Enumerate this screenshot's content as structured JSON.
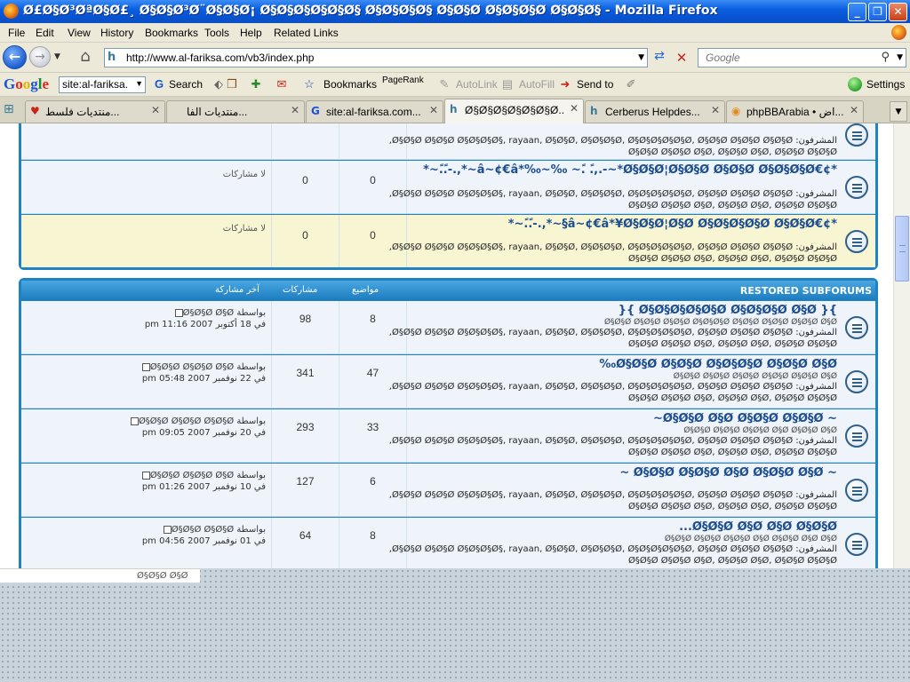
{
  "window": {
    "title": "Ø£Ø§Ø³ØªØ§Ø£¸ Ø§Ø§Ø³Ø¨Ø§Ø§Ø¡ Ø§Ø§Ø§Ø§Ø§Ø§ Ø§Ø§Ø§Ø§ Ø§Ø§Ø Ø§Ø§Ø§Ø Ø§Ø§Ø§ - Mozilla Firefox",
    "min_label": "_",
    "max_label": "❐",
    "close_label": "✕"
  },
  "menu": [
    "File",
    "Edit",
    "View",
    "History",
    "Bookmarks",
    "Tools",
    "Help",
    "Related Links"
  ],
  "nav": {
    "url": "http://www.al-fariksa.com/vb3/index.php",
    "search_placeholder": "Google"
  },
  "google_toolbar": {
    "logo": [
      "G",
      "o",
      "o",
      "g",
      "l",
      "e"
    ],
    "input_value": "site:al-fariksa.",
    "search_label": "Search",
    "bookmarks_label": "Bookmarks",
    "pagerank_label": "PageRank",
    "autolink_label": "AutoLink",
    "autofill_label": "AutoFill",
    "sendto_label": "Send to",
    "settings_label": "Settings"
  },
  "tabs": [
    {
      "label": "منتديات فلسط...",
      "active": false
    },
    {
      "label": "منتديات الفا...",
      "active": false
    },
    {
      "label": "site:al-fariksa.com...",
      "active": false
    },
    {
      "label": "Ø§Ø§Ø§Ø§Ø§Ø§Ø...",
      "active": true
    },
    {
      "label": "Cerberus Helpdes...",
      "active": false
    },
    {
      "label": "phpBBArabia • اض...",
      "active": false
    }
  ],
  "content": {
    "box1_rows": [
      {
        "mods_line1": "المشرفون: Ø§Ø§Ø Ø§Ø§Ø Ø§Ø§Ø§Ø§, rayaan, Ø§Ø§Ø, Ø§Ø§Ø§Ø, Ø§Ø§Ø§Ø§Ø§Ø, Ø§Ø§Ø Ø§Ø§Ø Ø§Ø§Ø,",
        "mods_line2": "Ø§Ø§Ø Ø§Ø§Ø Ø§Ø, Ø§Ø§Ø Ø§Ø, Ø§Ø§Ø Ø§Ø§Ø"
      },
      {
        "title": "*¢€â~¢€â*‰~‰ ~.ً .ً,.-~*Ø§Ø§Ø¦Ø§Ø§Ø Ø§Ø§Ø Ø§Ø§Ø§Ø~*,.-.ً.ً~*",
        "mods_line1": "المشرفون: Ø§Ø§Ø Ø§Ø§Ø Ø§Ø§Ø§Ø§, rayaan, Ø§Ø§Ø, Ø§Ø§Ø§Ø, Ø§Ø§Ø§Ø§Ø§Ø, Ø§Ø§Ø Ø§Ø§Ø Ø§Ø§Ø,",
        "mods_line2": "Ø§Ø§Ø Ø§Ø§Ø Ø§Ø, Ø§Ø§Ø Ø§Ø, Ø§Ø§Ø Ø§Ø§Ø",
        "topics": "0",
        "posts": "0",
        "last": "لا مشاركات"
      },
      {
        "title": "*¢€â~¢€â*¥Ø§Ø§Ø¦Ø§Ø Ø§Ø§Ø§Ø§Ø Ø§Ø§Ø§~*,.-.ً.ً~*",
        "mods_line1": "المشرفون: Ø§Ø§Ø Ø§Ø§Ø Ø§Ø§Ø§Ø§, rayaan, Ø§Ø§Ø, Ø§Ø§Ø§Ø, Ø§Ø§Ø§Ø§Ø§Ø, Ø§Ø§Ø Ø§Ø§Ø Ø§Ø§Ø,",
        "mods_line2": "Ø§Ø§Ø Ø§Ø§Ø Ø§Ø, Ø§Ø§Ø Ø§Ø, Ø§Ø§Ø Ø§Ø§Ø",
        "topics": "0",
        "posts": "0",
        "last": "لا مشاركات"
      }
    ],
    "box2_header": {
      "name": "RESTORED SUBFORUMS",
      "topics": "مواضيع",
      "posts": "مشاركات",
      "last": "آخر مشاركة"
    },
    "box2_rows": [
      {
        "title": "}{ Ø§Ø§Ø§Ø§Ø§Ø Ø§Ø§Ø§Ø Ø§Ø }{",
        "desc": "Ø§Ø§Ø Ø§Ø§Ø Ø§Ø§Ø Ø§Ø§Ø§Ø Ø§Ø§Ø Ø§Ø§Ø Ø§Ø§Ø Ø§Ø",
        "mods_line1": "المشرفون: Ø§Ø§Ø Ø§Ø§Ø Ø§Ø§Ø§Ø§, rayaan, Ø§Ø§Ø, Ø§Ø§Ø§Ø, Ø§Ø§Ø§Ø§Ø§Ø, Ø§Ø§Ø Ø§Ø§Ø Ø§Ø§Ø,",
        "mods_line2": "Ø§Ø§Ø Ø§Ø§Ø Ø§Ø, Ø§Ø§Ø Ø§Ø, Ø§Ø§Ø Ø§Ø§Ø",
        "topics": "8",
        "posts": "98",
        "last_by": "بواسطة Ø§Ø§Ø Ø§Ø",
        "last_date": "في 18 أكتوبر 2007 11:16 pm"
      },
      {
        "title": "Ø§Ø§Ø Ø§Ø§Ø Ø§Ø§Ø§Ø Ø§Ø§Ø Ø§Ø‰",
        "desc": "Ø§Ø§Ø Ø§Ø§Ø Ø§Ø§Ø Ø§Ø§Ø Ø§Ø§Ø Ø§Ø",
        "mods_line1": "المشرفون: Ø§Ø§Ø Ø§Ø§Ø Ø§Ø§Ø§Ø§, rayaan, Ø§Ø§Ø, Ø§Ø§Ø§Ø, Ø§Ø§Ø§Ø§Ø§Ø, Ø§Ø§Ø Ø§Ø§Ø Ø§Ø§Ø,",
        "mods_line2": "Ø§Ø§Ø Ø§Ø§Ø Ø§Ø, Ø§Ø§Ø Ø§Ø, Ø§Ø§Ø Ø§Ø§Ø",
        "topics": "47",
        "posts": "341",
        "last_by": "بواسطة Ø§Ø§Ø Ø§Ø§Ø Ø§Ø",
        "last_date": "في 22 نوفمبر 2007 05:48 pm"
      },
      {
        "title": "~ Ø§Ø§Ø Ø§Ø Ø§Ø§Ø Ø§Ø§Ø~",
        "desc": "Ø§Ø§Ø Ø§Ø§Ø Ø§Ø§Ø Ø§Ø Ø§Ø§Ø Ø§Ø",
        "mods_line1": "المشرفون: Ø§Ø§Ø Ø§Ø§Ø Ø§Ø§Ø§Ø§, rayaan, Ø§Ø§Ø, Ø§Ø§Ø§Ø, Ø§Ø§Ø§Ø§Ø§Ø, Ø§Ø§Ø Ø§Ø§Ø Ø§Ø§Ø,",
        "mods_line2": "Ø§Ø§Ø Ø§Ø§Ø Ø§Ø, Ø§Ø§Ø Ø§Ø, Ø§Ø§Ø Ø§Ø§Ø",
        "topics": "33",
        "posts": "293",
        "last_by": "بواسطة Ø§Ø§Ø Ø§Ø§Ø Ø§Ø§Ø",
        "last_date": "في 20 نوفمبر 2007 09:05 pm"
      },
      {
        "title": "~ Ø§Ø§Ø Ø§Ø§Ø Ø§Ø Ø§Ø§Ø Ø§Ø ~",
        "desc": "",
        "mods_line1": "المشرفون: Ø§Ø§Ø Ø§Ø§Ø Ø§Ø§Ø§Ø§, rayaan, Ø§Ø§Ø, Ø§Ø§Ø§Ø, Ø§Ø§Ø§Ø§Ø§Ø, Ø§Ø§Ø Ø§Ø§Ø Ø§Ø§Ø,",
        "mods_line2": "Ø§Ø§Ø Ø§Ø§Ø Ø§Ø, Ø§Ø§Ø Ø§Ø, Ø§Ø§Ø Ø§Ø§Ø",
        "topics": "6",
        "posts": "127",
        "last_by": "بواسطة Ø§Ø§Ø Ø§Ø§Ø Ø§Ø",
        "last_date": "في 10 نوفمبر 2007 01:26 pm"
      },
      {
        "title": "Ø§Ø§Ø Ø§Ø Ø§Ø Ø§Ø§Ø...",
        "desc": "Ø§Ø§Ø Ø§Ø§Ø Ø§Ø§Ø Ø§Ø Ø§Ø§Ø Ø§Ø Ø§Ø",
        "mods_line1": "المشرفون: Ø§Ø§Ø Ø§Ø§Ø Ø§Ø§Ø§Ø§, rayaan, Ø§Ø§Ø, Ø§Ø§Ø§Ø, Ø§Ø§Ø§Ø§Ø§Ø, Ø§Ø§Ø Ø§Ø§Ø Ø§Ø§Ø,",
        "mods_line2": "Ø§Ø§Ø Ø§Ø§Ø Ø§Ø, Ø§Ø§Ø Ø§Ø, Ø§Ø§Ø Ø§Ø§Ø",
        "topics": "8",
        "posts": "64",
        "last_by": "بواسطة Ø§Ø§Ø Ø§Ø§Ø",
        "last_date": "في 01 نوفمبر 2007 04:56 pm"
      }
    ],
    "status_text": "Ø§Ø§Ø Ø§Ø"
  }
}
